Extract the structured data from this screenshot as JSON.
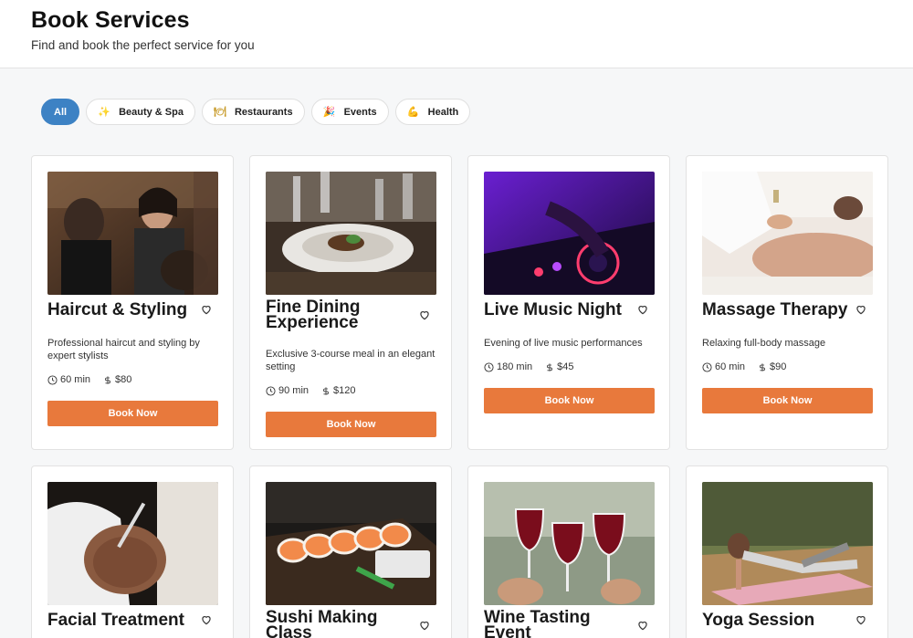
{
  "header": {
    "title": "Book Services",
    "subtitle": "Find and book the perfect service for you"
  },
  "filters": [
    {
      "label": "All",
      "icon": "",
      "active": true
    },
    {
      "label": "Beauty & Spa",
      "icon": "sparkles-icon",
      "emoji": "✨"
    },
    {
      "label": "Restaurants",
      "icon": "fork-knife-icon",
      "emoji": "🍽"
    },
    {
      "label": "Events",
      "icon": "party-popper-icon",
      "emoji": "🎉"
    },
    {
      "label": "Health",
      "icon": "flexed-biceps-icon",
      "emoji": "💪"
    }
  ],
  "book_label": "Book Now",
  "colors": {
    "accent": "#3d82c4",
    "book_button": "#e8793c"
  },
  "services": [
    {
      "title": "Haircut & Styling",
      "description": "Professional haircut and styling by expert stylists",
      "duration": "60 min",
      "price": "$80",
      "image": "barbershop"
    },
    {
      "title": "Fine Dining Experience",
      "description": "Exclusive 3-course meal in an elegant setting",
      "duration": "90 min",
      "price": "$120",
      "image": "plated dish"
    },
    {
      "title": "Live Music Night",
      "description": "Evening of live music performances",
      "duration": "180 min",
      "price": "$45",
      "image": "dj mixer"
    },
    {
      "title": "Massage Therapy",
      "description": "Relaxing full-body massage",
      "duration": "60 min",
      "price": "$90",
      "image": "oil massage"
    },
    {
      "title": "Facial Treatment",
      "image": "facial mask"
    },
    {
      "title": "Sushi Making Class",
      "image": "sushi rolls"
    },
    {
      "title": "Wine Tasting Event",
      "image": "wine glasses toast"
    },
    {
      "title": "Yoga Session",
      "image": "yoga pose"
    }
  ]
}
